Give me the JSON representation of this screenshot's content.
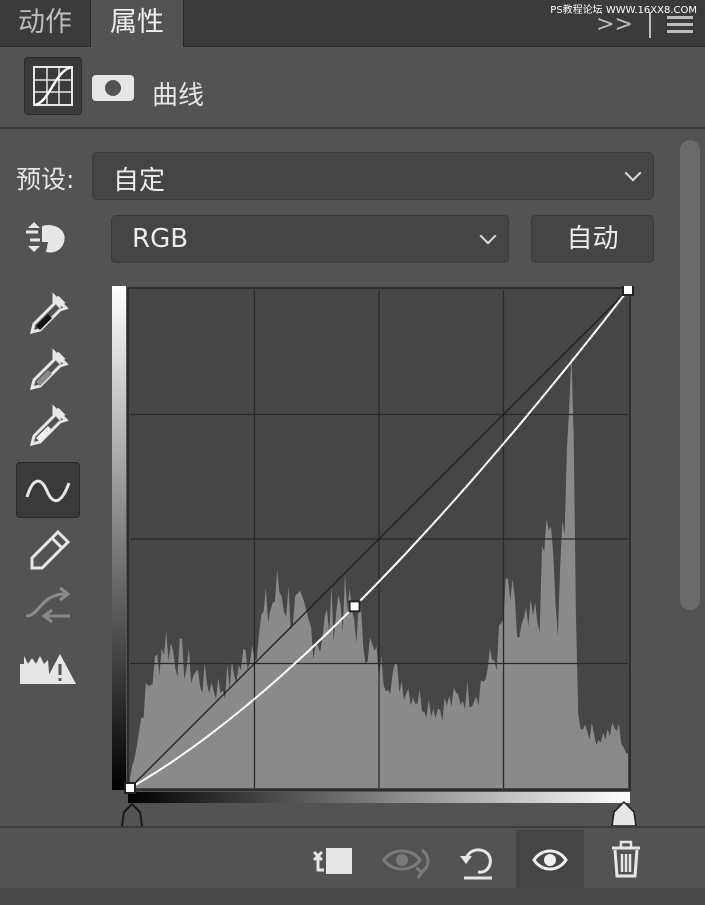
{
  "tabs": [
    {
      "label": "动作",
      "active": false
    },
    {
      "label": "属性",
      "active": true
    }
  ],
  "tabbar": {
    "watermark": "PS教程论坛 WWW.16XX8.COM",
    "collapse_glyph": ">>"
  },
  "header": {
    "title": "曲线"
  },
  "preset": {
    "label": "预设:",
    "value": "自定"
  },
  "channel": {
    "value": "RGB",
    "auto_label": "自动"
  },
  "curve": {
    "points": [
      [
        0,
        0
      ],
      [
        115,
        93
      ],
      [
        255,
        255
      ]
    ],
    "input_black": 0,
    "input_white": 255
  },
  "colors": {
    "panel_bg": "#535353",
    "graph_bg": "#464646",
    "histogram": "#8a8a8a",
    "curve_line": "#ffffff"
  }
}
